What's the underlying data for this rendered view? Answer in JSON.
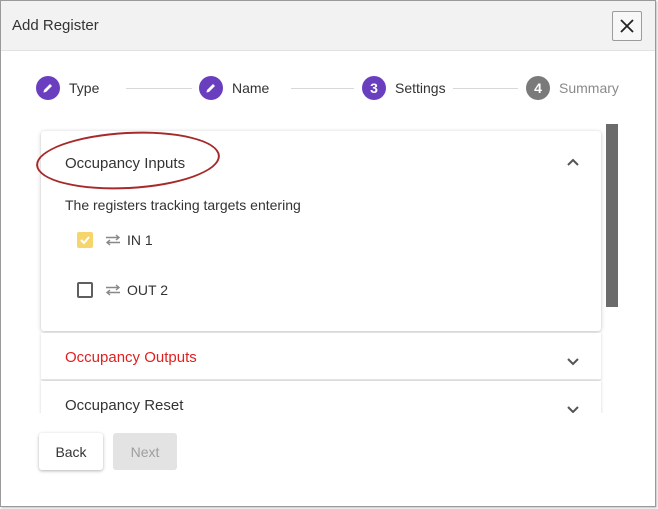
{
  "dialog": {
    "title": "Add Register",
    "close_icon": "close-icon"
  },
  "stepper": {
    "steps": [
      {
        "label": "Type",
        "state": "done",
        "icon": "pencil-icon"
      },
      {
        "label": "Name",
        "state": "done",
        "icon": "pencil-icon"
      },
      {
        "label": "Settings",
        "state": "active",
        "number": "3"
      },
      {
        "label": "Summary",
        "state": "pending",
        "number": "4"
      }
    ]
  },
  "sections": {
    "inputs": {
      "title": "Occupancy Inputs",
      "description": "The registers tracking targets entering",
      "options": [
        {
          "label": "IN 1",
          "checked": true
        },
        {
          "label": "OUT 2",
          "checked": false
        }
      ]
    },
    "outputs": {
      "title": "Occupancy Outputs"
    },
    "reset": {
      "title": "Occupancy Reset"
    }
  },
  "actions": {
    "back_label": "Back",
    "next_label": "Next"
  },
  "colors": {
    "accent": "#6a3fbf",
    "inactive": "#7a7a7a",
    "checkbox_checked": "#f6d66b",
    "error_text": "#e02020",
    "annotation": "#a72a2a"
  }
}
